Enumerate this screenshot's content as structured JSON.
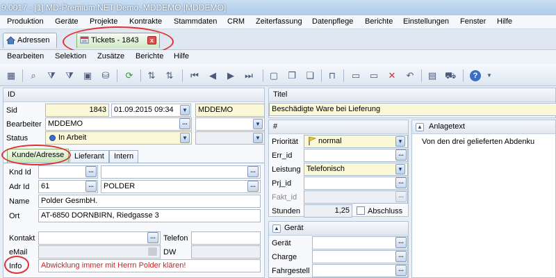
{
  "window": {
    "title": "9.0017 - [1] MD-Premium.NET Demo, MDDEMO [MDDEMO]"
  },
  "menu": [
    "Produktion",
    "Geräte",
    "Projekte",
    "Kontrakte",
    "Stammdaten",
    "CRM",
    "Zeiterfassung",
    "Datenpflege",
    "Berichte",
    "Einstellungen",
    "Fenster",
    "Hilfe"
  ],
  "doc_tabs": [
    {
      "label": "Adressen"
    },
    {
      "label": "Tickets - 1843",
      "close": "x"
    }
  ],
  "submenu": [
    "Bearbeiten",
    "Selektion",
    "Zusätze",
    "Berichte",
    "Hilfe"
  ],
  "header": {
    "id_label": "ID",
    "sid_label": "Sid",
    "sid_value": "1843",
    "date_value": "01.09.2015 09:34",
    "user_value": "MDDEMO",
    "bearbeiter_label": "Bearbeiter",
    "bearbeiter_value": "MDDEMO",
    "status_label": "Status",
    "status_value": "In Arbeit",
    "titel_label": "Titel",
    "titel_value": "Beschädigte Ware bei Lieferung"
  },
  "subtabs": [
    "Kunde/Adresse",
    "Lieferant",
    "Intern"
  ],
  "kunde": {
    "knd_label": "Knd Id",
    "knd_value": "",
    "adr_label": "Adr Id",
    "adr_value": "61",
    "adr_name_value": "POLDER",
    "name_label": "Name",
    "name_value": "Polder GesmbH.",
    "ort_label": "Ort",
    "ort_value": "AT-6850 DORNBIRN, Riedgasse 3",
    "kontakt_label": "Kontakt",
    "telefon_label": "Telefon",
    "email_label": "eMail",
    "dw_label": "DW",
    "info_label": "Info",
    "info_value": "Abwicklung immer mit Herrn Polder klären!"
  },
  "mid": {
    "hash_label": "#",
    "prioritaet_label": "Priorität",
    "prioritaet_value": "normal",
    "err_label": "Err_id",
    "leistung_label": "Leistung",
    "leistung_value": "Telefonisch",
    "prj_label": "Prj_id",
    "fakt_label": "Fakt_id",
    "stunden_label": "Stunden",
    "stunden_value": "1,25",
    "abschluss_label": "Abschluss"
  },
  "geraet": {
    "header": "Gerät",
    "geraet_label": "Gerät",
    "charge_label": "Charge",
    "fahrgestell_label": "Fahrgestell"
  },
  "anlagetext": {
    "header": "Anlagetext",
    "text": "Von den drei gelieferten Abdenku"
  },
  "colors": {
    "accent": "#e03030",
    "field_yellow": "#fbf8d8",
    "active_tab_green": "#c6e6b6"
  }
}
